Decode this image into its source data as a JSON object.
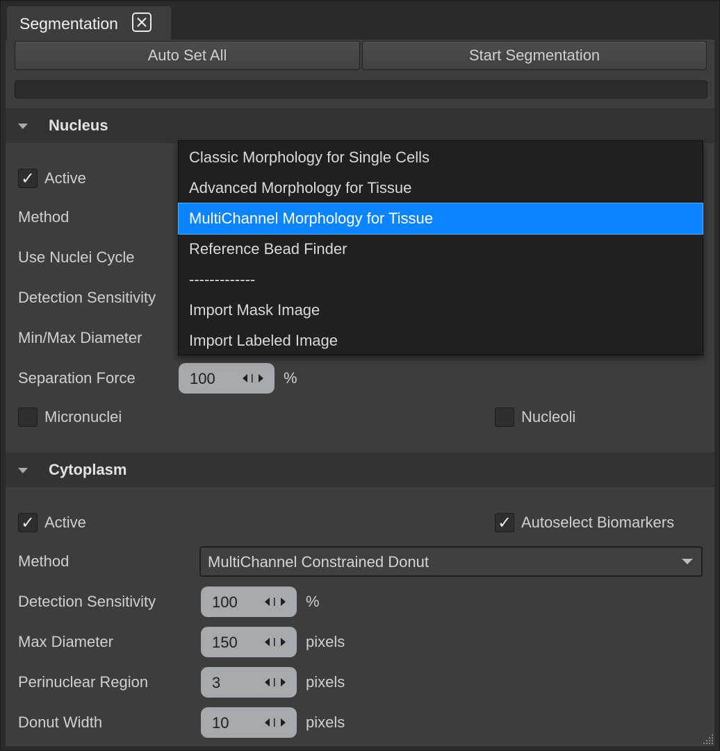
{
  "tab": {
    "title": "Segmentation"
  },
  "toolbar": {
    "auto_set_all": "Auto Set All",
    "start_segmentation": "Start Segmentation"
  },
  "progress": {
    "value": 0
  },
  "nucleus": {
    "title": "Nucleus",
    "active_label": "Active",
    "active_checked": true,
    "method_label": "Method",
    "use_nuclei_cycle_label": "Use Nuclei Cycle",
    "detection_sensitivity_label": "Detection Sensitivity",
    "min_max_diameter_label": "Min/Max Diameter",
    "separation_force_label": "Separation Force",
    "separation_force_value": "100",
    "separation_force_unit": "%",
    "micronuclei_label": "Micronuclei",
    "micronuclei_checked": false,
    "nucleoli_label": "Nucleoli",
    "nucleoli_checked": false
  },
  "method_dropdown": {
    "items": [
      "Classic Morphology for Single Cells",
      "Advanced Morphology for Tissue",
      "MultiChannel Morphology for Tissue",
      "Reference Bead Finder",
      "-------------",
      "Import Mask Image",
      "Import Labeled Image"
    ],
    "selected_index": 2
  },
  "cytoplasm": {
    "title": "Cytoplasm",
    "active_label": "Active",
    "active_checked": true,
    "autoselect_label": "Autoselect Biomarkers",
    "autoselect_checked": true,
    "method_label": "Method",
    "method_value": "MultiChannel Constrained Donut",
    "detection_sensitivity_label": "Detection Sensitivity",
    "detection_sensitivity_value": "100",
    "detection_sensitivity_unit": "%",
    "max_diameter_label": "Max Diameter",
    "max_diameter_value": "150",
    "max_diameter_unit": "pixels",
    "perinuclear_region_label": "Perinuclear Region",
    "perinuclear_region_value": "3",
    "perinuclear_region_unit": "pixels",
    "donut_width_label": "Donut Width",
    "donut_width_value": "10",
    "donut_width_unit": "pixels"
  },
  "colors": {
    "accent": "#0a84ff",
    "panel": "#3d3d3d",
    "section_header": "#333333"
  }
}
